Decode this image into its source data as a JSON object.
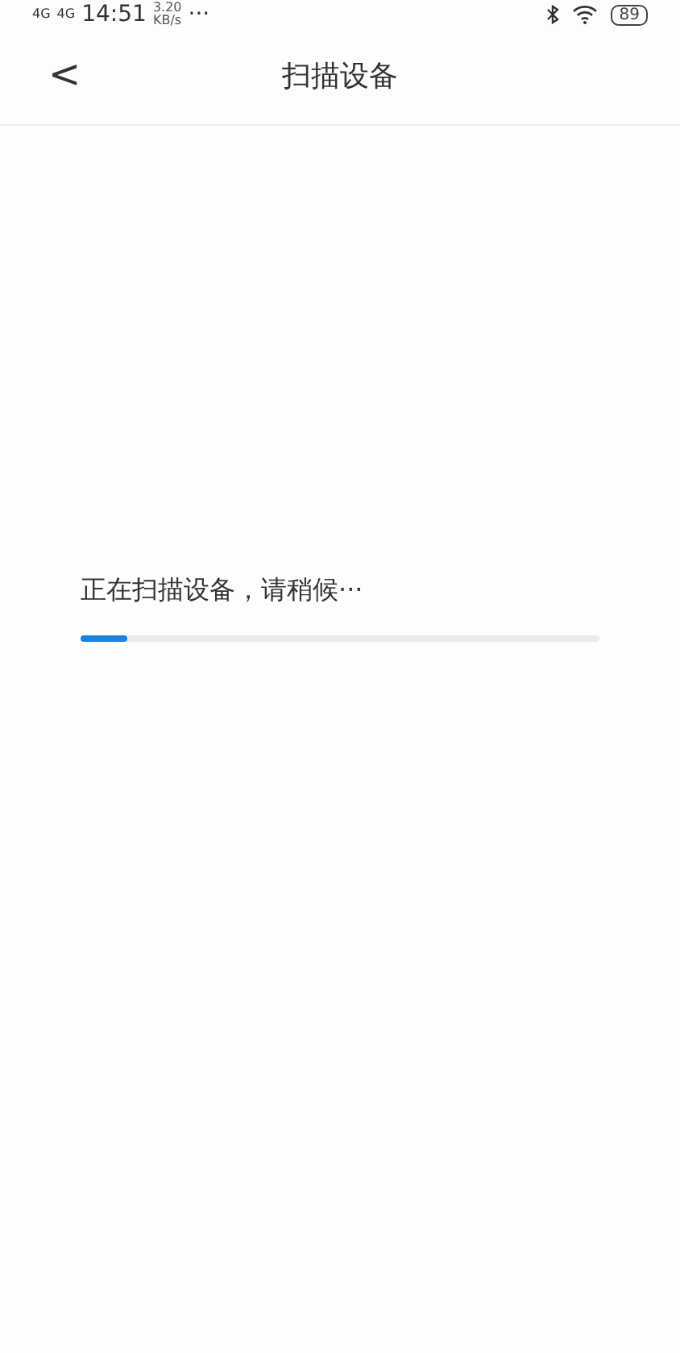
{
  "status_bar": {
    "signal_labels": [
      "4G",
      "4G"
    ],
    "time": "14:51",
    "speed_value": "3.20",
    "speed_unit": "KB/s",
    "more": "···",
    "battery": "89"
  },
  "header": {
    "back": "<",
    "title": "扫描设备"
  },
  "scan": {
    "message": "正在扫描设备，请稍候···",
    "level": 0.09
  }
}
